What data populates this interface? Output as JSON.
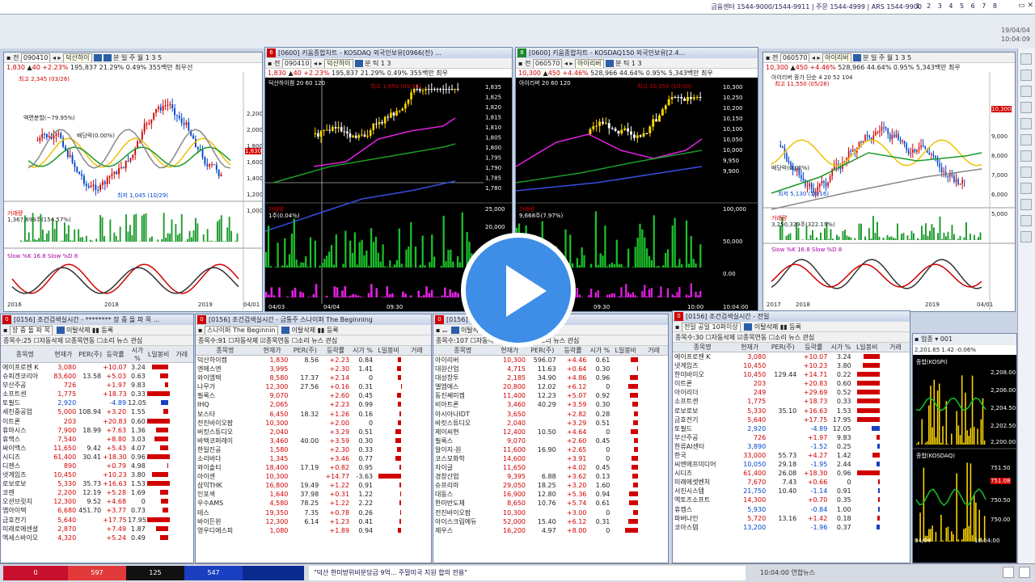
{
  "topbar": {
    "info": "금융센터 1544-9000/1544-9911 | 주문 1544-4999 | ARS 1544-9900",
    "pages": "1 2 3 4 5 6 7 8",
    "date": "19/04/04",
    "time": "10:04:09"
  },
  "chart1": {
    "code": "090410",
    "name": "덕산하이",
    "price": "1,830",
    "chg": "40",
    "pct": "+2.23%",
    "vol": "195,837",
    "r1": "21.29%",
    "r2": "0.49%",
    "r3": "355백만 최우선",
    "hi": "최고 2,345 (03/26)",
    "lo": "최저 1,045 (10/29)",
    "split": "액면분할(~79.95%)",
    "div": "배당락(0.00%)",
    "volLabel": "거래량",
    "volVal": "1,367,693주(154.57%)",
    "stoch": "Slow %K 16.8  Slow %D 8",
    "years": [
      "2016",
      "2018",
      "2019",
      "04/01"
    ],
    "yTicks": [
      "2,200",
      "2,000",
      "1,800",
      "1,600",
      "1,400",
      "1,200",
      "1,000"
    ],
    "cur": "1,830"
  },
  "chart2": {
    "title": "[0600] 키움종합차트 - KOSDAQ 외국인보유[0966(전) ...",
    "code": "090410",
    "name": "덕산하이",
    "price": "1,830",
    "chg": "40",
    "pct": "+2.23%",
    "vol": "195,837",
    "r1": "21.29%",
    "r2": "0.49%",
    "r3": "355백만 최우",
    "legend": "덕산하이켐  20  60  120",
    "yTicks": [
      "1,835",
      "1,825",
      "1,820",
      "1,815",
      "1,810",
      "1,805",
      "1,800",
      "1,795",
      "1,790",
      "1,785",
      "1,780"
    ],
    "hi": "최고 1,850 (09:56)",
    "volLabel": "거래량",
    "volVal": "1주(0.04%)",
    "volTicks": [
      "25,000",
      "20,000",
      "0"
    ],
    "times": [
      "04/03",
      "04/04",
      "09:30"
    ]
  },
  "chart3": {
    "title": "[0600] 키움종합차트 - KOSDAQ150 외국인보유[2.4...",
    "code": "060570",
    "name": "아이리버",
    "price": "10,300",
    "chg": "450",
    "pct": "+4.46%",
    "vol": "528,966",
    "r1": "44.64%",
    "r2": "0.95%",
    "r3": "5,343백만 최우",
    "legend": "아이리버  20  60  120",
    "yTicks": [
      "10,300",
      "10,250",
      "10,200",
      "10,150",
      "10,100",
      "10,050",
      "10,000",
      "9,950",
      "9,900"
    ],
    "hi": "최고 10,350 (10:00)",
    "volLabel": "거래량",
    "volVal": "9,668주(7.97%)",
    "volTicks": [
      "100,000",
      "50,000",
      "0.00"
    ],
    "times": [
      "09:30",
      "10:00",
      "10:04:00"
    ]
  },
  "chart4": {
    "code": "060570",
    "name": "아이리버",
    "price": "10,300",
    "chg": "450",
    "pct": "+4.46%",
    "vol": "528,966",
    "r1": "44.64%",
    "r2": "0.95%",
    "r3": "5,343백만 최우",
    "legend": "아이리버  종가 단순 4  20  52  104",
    "hi": "최고 11,550 (05/28)",
    "lo": "최저 5,130 (10/16)",
    "div": "배당락(0.00%)",
    "yTicks": [
      "10,300",
      "9,000",
      "8,000",
      "7,000",
      "6,000",
      "5,000"
    ],
    "volLabel": "거래량",
    "volVal": "3,250,329주(322.19%)",
    "stoch": "Slow %K 16.8  Slow %D 8",
    "years": [
      "2017",
      "2018",
      "2019",
      "04/01"
    ]
  },
  "scan1": {
    "title": "[0156] 조건검색실시간 - ******** 장 중 돌 파 목 ...",
    "cond": "장 중 돌 파 목",
    "count": "종목수:25",
    "cols": [
      "종목명",
      "현재가",
      "PER(주)",
      "등락률",
      "시가 %",
      "L일봉비",
      "거래"
    ],
    "rows": [
      [
        "에이프로젠 K",
        "3,080",
        "",
        "+10.07",
        "3.24",
        ""
      ],
      [
        "슈피겐코리아",
        "83,600",
        "13.58",
        "+5.03",
        "0.63",
        ""
      ],
      [
        "부산주공",
        "726",
        "",
        "+1.97",
        "9.83",
        ""
      ],
      [
        "소프트센",
        "1,775",
        "",
        "+18.73",
        "0.33",
        ""
      ],
      [
        "토필드",
        "2,920",
        "",
        "-4.89",
        "12.05",
        ""
      ],
      [
        "세진중공업",
        "5,000",
        "108.94",
        "+3.20",
        "1.55",
        ""
      ],
      [
        "이트론",
        "203",
        "",
        "+20.83",
        "0.60",
        ""
      ],
      [
        "휴마시스",
        "7,900",
        "18.99",
        "+7.63",
        "1.36",
        ""
      ],
      [
        "휴맥스",
        "7,540",
        "",
        "+8.80",
        "3.03",
        ""
      ],
      [
        "싸이맥스",
        "11,650",
        "9.42",
        "+5.43",
        "4.07",
        ""
      ],
      [
        "시디즈",
        "61,400",
        "30.41",
        "+18.30",
        "0.96",
        ""
      ],
      [
        "디젠스",
        "890",
        "",
        "+0.79",
        "4.98",
        ""
      ],
      [
        "넷게임즈",
        "10,450",
        "",
        "+10.23",
        "3.80",
        ""
      ],
      [
        "로보로보",
        "5,330",
        "35.73",
        "+16.63",
        "1.53",
        ""
      ],
      [
        "코렌",
        "2,200",
        "12.19",
        "+5.28",
        "1.69",
        ""
      ],
      [
        "오션브릿지",
        "12,300",
        "9.52",
        "+4.68",
        "0",
        ""
      ],
      [
        "엠아이텍",
        "6,680",
        "451.70",
        "+3.77",
        "0.73",
        ""
      ],
      [
        "금호전기",
        "5,640",
        "",
        "+17.75",
        "17.95",
        ""
      ],
      [
        "미래로에센셜",
        "2,870",
        "",
        "+7.49",
        "1.87",
        ""
      ],
      [
        "엑세스바이오",
        "4,320",
        "",
        "+5.24",
        "0.49",
        ""
      ]
    ]
  },
  "scan2": {
    "title": "[0156] 조건검색실시간 - 금통주 스나이퍼 The Beginning",
    "cond": "스나이퍼 The Beginnin",
    "count": "종목수:91",
    "cols": [
      "종목명",
      "현재가",
      "PER(주)",
      "등락률",
      "시가 %",
      "L일봉비",
      "거래"
    ],
    "rows": [
      [
        "덕산하이켐",
        "1,830",
        "8.56",
        "+2.23",
        "0.84",
        ""
      ],
      [
        "엔에스엔",
        "3,995",
        "",
        "+2.30",
        "1.41",
        ""
      ],
      [
        "와이엠텍",
        "8,580",
        "17.37",
        "+2.14",
        "0",
        ""
      ],
      [
        "나무가",
        "12,300",
        "27.56",
        "+0.16",
        "0.31",
        ""
      ],
      [
        "필룩스",
        "9,070",
        "",
        "+2.60",
        "0.45",
        ""
      ],
      [
        "IHQ",
        "2,065",
        "",
        "+2.23",
        "0.99",
        ""
      ],
      [
        "보스타",
        "6,450",
        "18.32",
        "+1.26",
        "0.16",
        ""
      ],
      [
        "전진바이오팜",
        "10,300",
        "",
        "+2.00",
        "0",
        ""
      ],
      [
        "버킷스튜디오",
        "2,040",
        "",
        "+3.29",
        "0.51",
        ""
      ],
      [
        "바텍코퍼레이",
        "3,460",
        "40.00",
        "+3.59",
        "0.30",
        ""
      ],
      [
        "한일진공",
        "1,580",
        "",
        "+2.30",
        "0.33",
        ""
      ],
      [
        "소리바다",
        "1,345",
        "",
        "+3.46",
        "0.77",
        ""
      ],
      [
        "와이솔티",
        "18,400",
        "17.19",
        "+0.82",
        "0.95",
        ""
      ],
      [
        "아이센",
        "10,300",
        "",
        "+14.77",
        "-3.63",
        ""
      ],
      [
        "삼익THK",
        "16,800",
        "19.49",
        "+1.22",
        "0.91",
        ""
      ],
      [
        "인포섹",
        "1,640",
        "37.98",
        "+0.31",
        "1.22",
        ""
      ],
      [
        "우수AMS",
        "4,580",
        "78.25",
        "+1.22",
        "2.22",
        ""
      ],
      [
        "테스",
        "19,350",
        "7.35",
        "+0.78",
        "0.26",
        ""
      ],
      [
        "바이든윈",
        "12,300",
        "6.14",
        "+1.23",
        "0.41",
        ""
      ],
      [
        "영우디에스피",
        "1,080",
        "",
        "+1.89",
        "0.94",
        ""
      ]
    ]
  },
  "scan3": {
    "title": "[0156] 조건검색실시간 - ...",
    "count": "종목수:107",
    "cols": [
      "종목명",
      "현재가",
      "PER(주)",
      "등락률",
      "시가 %",
      "L일봉비",
      "거래"
    ],
    "rows": [
      [
        "아이리버",
        "10,300",
        "596.07",
        "+4.46",
        "0.61",
        ""
      ],
      [
        "대원산업",
        "4,715",
        "11.63",
        "+0.64",
        "0.30",
        ""
      ],
      [
        "대성창투",
        "2,185",
        "34.90",
        "+4.86",
        "0.96",
        ""
      ],
      [
        "엘엠에스",
        "20,800",
        "12.02",
        "+6.12",
        "0",
        ""
      ],
      [
        "동진쎄미켐",
        "11,400",
        "12.23",
        "+5.07",
        "0.92",
        ""
      ],
      [
        "비아트론",
        "3,460",
        "40.29",
        "+3.59",
        "0.30",
        ""
      ],
      [
        "아시아나IDT",
        "3,650",
        "",
        "+2.82",
        "0.28",
        ""
      ],
      [
        "바킷스튜디오",
        "2,040",
        "",
        "+3.29",
        "0.51",
        ""
      ],
      [
        "제이씨현",
        "12,400",
        "10.50",
        "+4.64",
        "0",
        ""
      ],
      [
        "필룩스",
        "9,070",
        "",
        "+2.60",
        "0.45",
        ""
      ],
      [
        "알이지-원",
        "11,600",
        "16.90",
        "+2.65",
        "0",
        ""
      ],
      [
        "코스모화학",
        "14,600",
        "",
        "+3.91",
        "0",
        ""
      ],
      [
        "자이글",
        "11,650",
        "",
        "+4.02",
        "0.45",
        ""
      ],
      [
        "경창산업",
        "9,395",
        "6.88",
        "+3.62",
        "0.13",
        ""
      ],
      [
        "슈프리마",
        "29,050",
        "18.25",
        "+3.20",
        "1.60",
        ""
      ],
      [
        "대동스",
        "16,900",
        "12.80",
        "+5.36",
        "0.94",
        ""
      ],
      [
        "한미반도체",
        "8,650",
        "10.76",
        "+5.74",
        "0.61",
        ""
      ],
      [
        "전진바이오팜",
        "10,300",
        "",
        "+3.00",
        "0",
        ""
      ],
      [
        "아이스크림에듀",
        "52,000",
        "15.40",
        "+6.12",
        "0.31",
        ""
      ],
      [
        "제우스",
        "16,200",
        "4.97",
        "+8.00",
        "0",
        ""
      ]
    ]
  },
  "scan4": {
    "title": "[0156] 조건검색실시간 - 전일",
    "cond": "전일 공일 10퍼이상",
    "count": "종목수:30",
    "cols": [
      "종목명",
      "현재가",
      "PER(주)",
      "등락률",
      "시가 %",
      "L일봉비",
      "거래"
    ],
    "rows": [
      [
        "에이프로젠 K",
        "3,080",
        "",
        "+10.07",
        "3.24",
        ""
      ],
      [
        "넷게임즈",
        "10,450",
        "",
        "+10.23",
        "3.80",
        ""
      ],
      [
        "한미바이오",
        "10,450",
        "129.44",
        "+14.71",
        "0.22",
        ""
      ],
      [
        "이트론",
        "203",
        "",
        "+20.83",
        "0.60",
        ""
      ],
      [
        "아이리더",
        "249",
        "",
        "+29.69",
        "0.52",
        ""
      ],
      [
        "소프트센",
        "1,775",
        "",
        "+18.73",
        "0.33",
        ""
      ],
      [
        "로보로보",
        "5,330",
        "35.10",
        "+16.63",
        "1.53",
        ""
      ],
      [
        "금호전기",
        "5,640",
        "",
        "+17.75",
        "17.95",
        ""
      ],
      [
        "토필드",
        "2,920",
        "",
        "-4.89",
        "12.05",
        ""
      ],
      [
        "부산주공",
        "726",
        "",
        "+1.97",
        "9.83",
        ""
      ],
      [
        "한류AI센터",
        "3,890",
        "",
        "-1.52",
        "0.25",
        ""
      ],
      [
        "한국",
        "33,000",
        "55.73",
        "+4.27",
        "1.42",
        ""
      ],
      [
        "씨앤에프미디어",
        "10,050",
        "29.18",
        "-1.95",
        "2.44",
        ""
      ],
      [
        "시디즈",
        "61,400",
        "26.08",
        "+18.30",
        "0.96",
        ""
      ],
      [
        "미래에셋벤처",
        "7,670",
        "7.43",
        "+0.66",
        "0",
        ""
      ],
      [
        "서진시스템",
        "21,750",
        "10.40",
        "-1.14",
        "0.91",
        ""
      ],
      [
        "엑토즈소프트",
        "14,300",
        "",
        "+0.70",
        "0.35",
        ""
      ],
      [
        "휴켐스",
        "5,930",
        "",
        "-0.84",
        "1.00",
        ""
      ],
      [
        "파버나인",
        "5,720",
        "13.16",
        "+1.42",
        "0.18",
        ""
      ],
      [
        "코아스템",
        "13,200",
        "",
        "-1.96",
        "0.37",
        ""
      ]
    ]
  },
  "mini": {
    "top": "종합(KOSPI)",
    "topVals": [
      "2,208.00",
      "2,206.00",
      "2,204.50",
      "2,202.50",
      "2,200.00"
    ],
    "bot": "종합(KOSDAQ)",
    "botVals": [
      "751.50",
      "751.08",
      "750.50",
      "750.00"
    ],
    "cur": "751.08",
    "date": "04/04",
    "time": "10:04:00",
    "head": "2,201.65  1.42  -0.06%"
  },
  "bottom": {
    "s1": "0",
    "s2": "597",
    "s3": "125",
    "s4": "547",
    "ticker": "\"덕산 한미방위비분담금 9억... 주말미국 지원 합의 전용\"",
    "clock": "10:04:00  연합뉴스"
  },
  "colors": {
    "up": "#d10000",
    "down": "#0044cc",
    "candleUp": "#d10000",
    "candleDown": "#0044cc",
    "maYellow": "#f0c000",
    "maGreen": "#1a9a2a",
    "maMagenta": "#e020e0"
  }
}
